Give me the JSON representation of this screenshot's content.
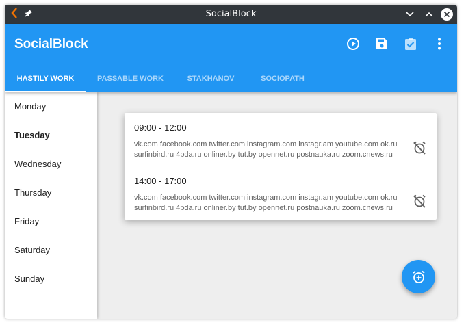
{
  "window": {
    "title": "SocialBlock"
  },
  "appbar": {
    "title": "SocialBlock",
    "accent": "#2196f3",
    "actions": [
      {
        "icon": "play-circle-icon"
      },
      {
        "icon": "save-icon"
      },
      {
        "icon": "clipboard-check-icon"
      },
      {
        "icon": "more-vert-icon"
      }
    ]
  },
  "tabs": [
    {
      "label": "HASTILY WORK",
      "active": true
    },
    {
      "label": "PASSABLE WORK",
      "active": false
    },
    {
      "label": "STAKHANOV",
      "active": false
    },
    {
      "label": "SOCIOPATH",
      "active": false
    }
  ],
  "days": [
    {
      "label": "Monday",
      "selected": false
    },
    {
      "label": "Tuesday",
      "selected": true
    },
    {
      "label": "Wednesday",
      "selected": false
    },
    {
      "label": "Thursday",
      "selected": false
    },
    {
      "label": "Friday",
      "selected": false
    },
    {
      "label": "Saturday",
      "selected": false
    },
    {
      "label": "Sunday",
      "selected": false
    }
  ],
  "schedule": [
    {
      "time": "09:00 - 12:00",
      "sites": "vk.com facebook.com twitter.com instagram.com instagr.am youtube.com ok.ru surfinbird.ru 4pda.ru onliner.by tut.by opennet.ru postnauka.ru zoom.cnews.ru"
    },
    {
      "time": "14:00 - 17:00",
      "sites": "vk.com facebook.com twitter.com instagram.com instagr.am youtube.com ok.ru surfinbird.ru 4pda.ru onliner.by tut.by opennet.ru postnauka.ru zoom.cnews.ru"
    }
  ],
  "fab": {
    "icon": "add-alarm-icon"
  }
}
